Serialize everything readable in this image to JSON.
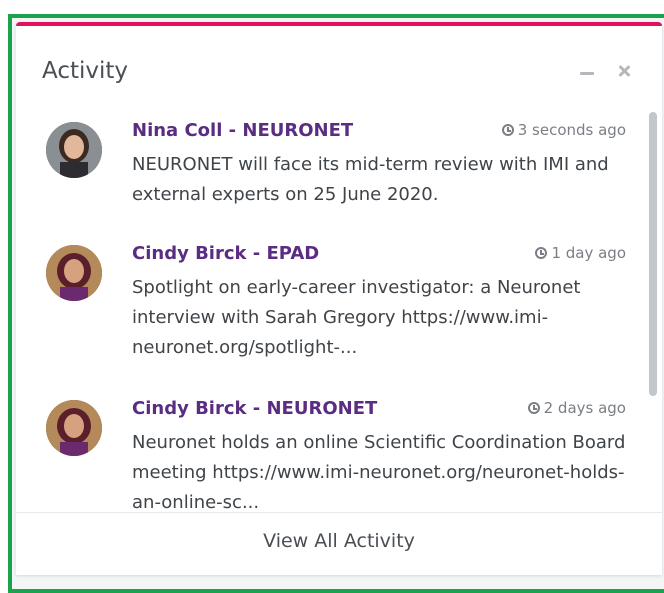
{
  "widget": {
    "title": "Activity",
    "minimize_icon": "minimize-icon",
    "close_icon": "close-icon"
  },
  "activities": [
    {
      "name": "Nina Coll - NEURONET",
      "time": "3 seconds ago",
      "text": "NEURONET will face its mid-term review with IMI and external experts on 25 June 2020."
    },
    {
      "name": "Cindy Birck - EPAD",
      "time": "1 day ago",
      "text": "Spotlight on early-career investigator: a Neuronet interview with Sarah Gregory https://www.imi-neuronet.org/spotlight-..."
    },
    {
      "name": "Cindy Birck - NEURONET",
      "time": "2 days ago",
      "text": "Neuronet holds an online Scientific Coordination Board meeting https://www.imi-neuronet.org/neuronet-holds-an-online-sc..."
    }
  ],
  "footer": {
    "view_all_label": "View All Activity"
  },
  "colors": {
    "accent": "#e0125c",
    "name": "#5a2d82",
    "frame": "#1aa34a"
  }
}
